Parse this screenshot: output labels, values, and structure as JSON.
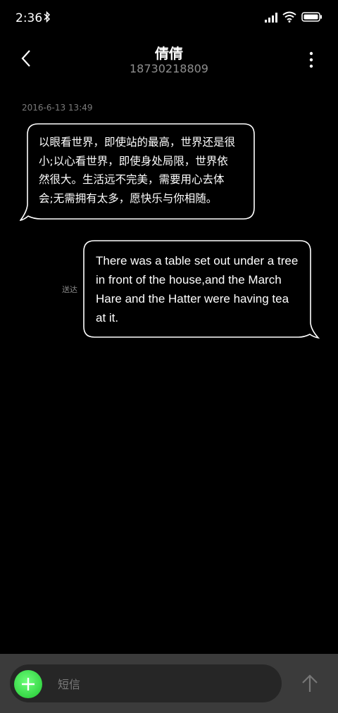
{
  "status_bar": {
    "time": "2:36"
  },
  "header": {
    "contact_name": "倩倩",
    "contact_number": "18730218809"
  },
  "conversation": {
    "timestamp": "2016-6-13 13:49",
    "messages": [
      {
        "direction": "incoming",
        "lines": [
          "以眼看世界，即使站的最高，世界还是很",
          "小;以心看世界，即使身处局限，世界依",
          "然很大。生活远不完美，需要用心去体",
          "会;无需拥有太多，愿快乐与你相随。"
        ]
      },
      {
        "direction": "outgoing",
        "lines": [
          "There was a table set out under a tree",
          "in front of the house,and the March",
          "Hare and the Hatter were having tea",
          "at it."
        ],
        "status": "送达"
      }
    ]
  },
  "composer": {
    "placeholder": "短信"
  },
  "colors": {
    "accent_green": "#2ed93c",
    "background": "#000000",
    "composer_bg": "#3b3b3b"
  }
}
